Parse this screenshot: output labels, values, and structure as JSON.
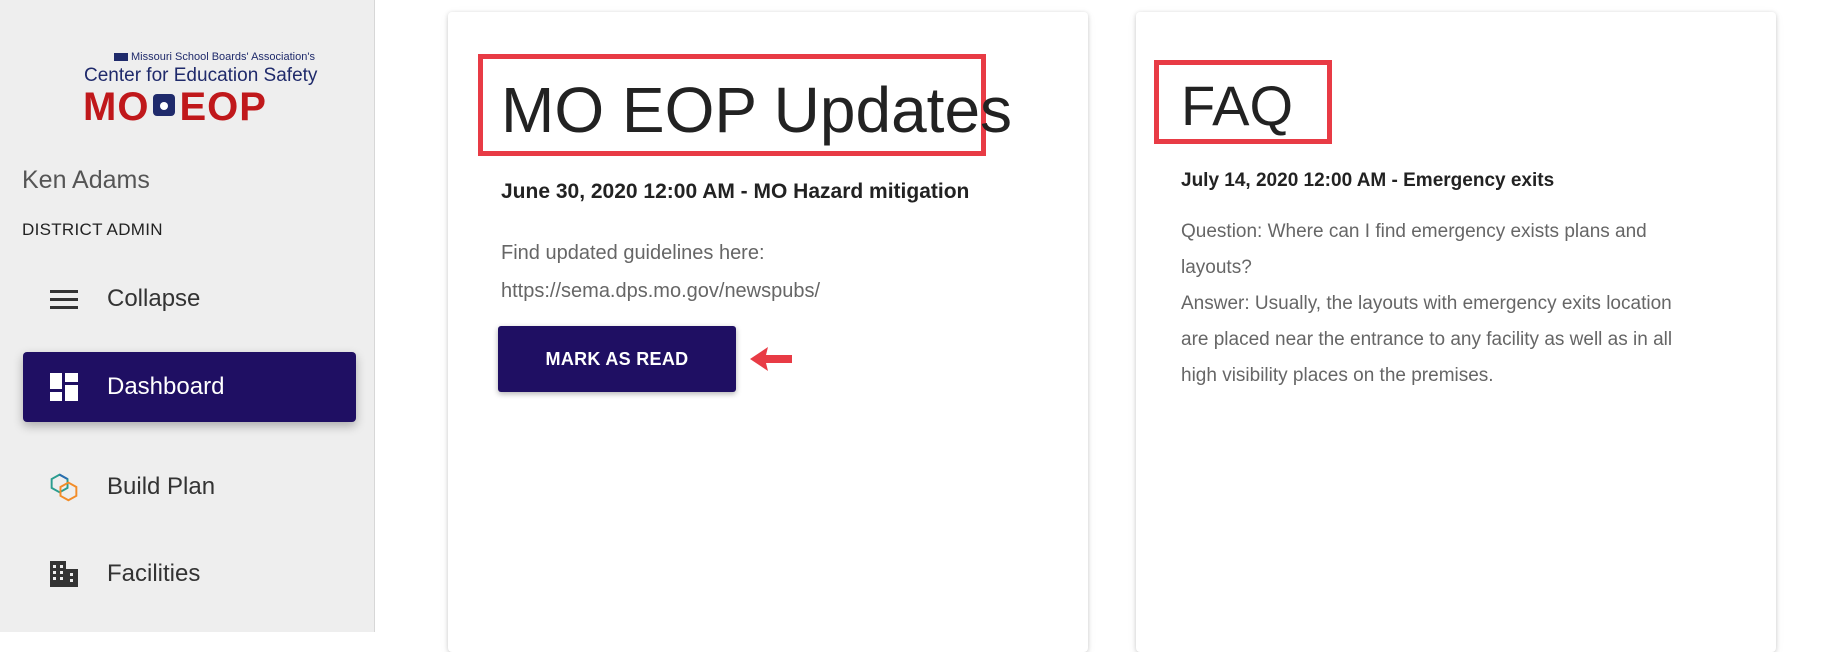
{
  "sidebar": {
    "logo": {
      "tagline": "Missouri School Boards' Association's",
      "center": "Center for Education Safety",
      "brand_left": "MO",
      "brand_right": "EOP"
    },
    "user": {
      "name": "Ken Adams",
      "role": "DISTRICT ADMIN"
    },
    "nav": [
      {
        "label": "Collapse",
        "icon": "menu-icon"
      },
      {
        "label": "Dashboard",
        "icon": "dashboard-icon",
        "active": true
      },
      {
        "label": "Build Plan",
        "icon": "build-plan-icon"
      },
      {
        "label": "Facilities",
        "icon": "building-icon"
      }
    ]
  },
  "cards": {
    "updates": {
      "title": "MO EOP Updates",
      "post_heading": "June 30, 2020 12:00 AM - MO Hazard mitigation",
      "body_line1": "Find updated guidelines here:",
      "body_line2": "https://sema.dps.mo.gov/newspubs/",
      "button_label": "MARK AS READ"
    },
    "faq": {
      "title": "FAQ",
      "post_heading": "July 14, 2020 12:00 AM - Emergency exits",
      "body_line1": "Question: Where can I find emergency exists plans and",
      "body_line2": "layouts?",
      "body_line3": "Answer: Usually, the layouts with emergency exits location",
      "body_line4": "are placed near the entrance to any facility as well as in all",
      "body_line5": "high visibility places on the premises."
    }
  },
  "colors": {
    "primary": "#1f0f63",
    "highlight": "#e83b45",
    "brand_red": "#c0181b",
    "brand_navy": "#1f2a6b"
  }
}
